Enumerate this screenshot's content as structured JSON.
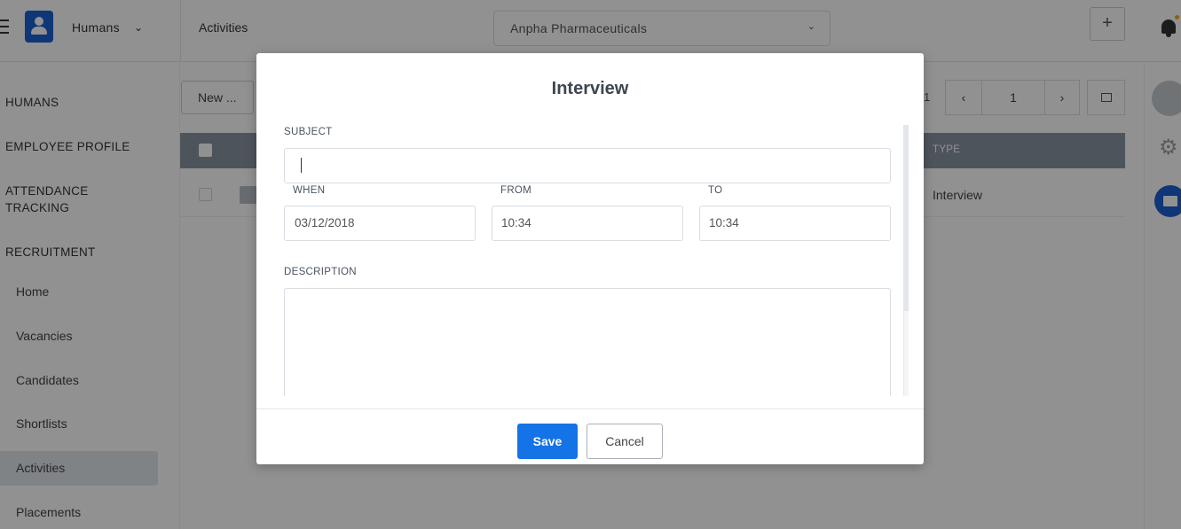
{
  "app": {
    "switcher_label": "Humans",
    "page_title": "Activities",
    "company": "Anpha Pharmaceuticals",
    "add_label": "+"
  },
  "sidebar": {
    "sections": [
      "HUMANS",
      "EMPLOYEE PROFILE",
      "ATTENDANCE TRACKING",
      "RECRUITMENT"
    ],
    "items": [
      "Home",
      "Vacancies",
      "Candidates",
      "Shortlists",
      "Activities",
      "Placements"
    ],
    "active_item": "Activities"
  },
  "toolbar": {
    "new_label": "New ...",
    "pager_count": "1",
    "pager_page": "1",
    "prev_icon": "‹",
    "next_icon": "›"
  },
  "table": {
    "columns": [
      "TYPE"
    ],
    "rows": [
      {
        "type": "Interview"
      }
    ]
  },
  "modal": {
    "title": "Interview",
    "subject_label": "SUBJECT",
    "subject_value": "",
    "when_label": "WHEN",
    "when_value": "03/12/2018",
    "from_label": "FROM",
    "from_value": "10:34",
    "to_label": "TO",
    "to_value": "10:34",
    "description_label": "DESCRIPTION",
    "description_value": "",
    "save_label": "Save",
    "cancel_label": "Cancel"
  },
  "colors": {
    "primary": "#1473e6",
    "brand": "#1b5fd1",
    "table_header": "#8a95a3",
    "notification": "#f5a623"
  },
  "icons": [
    "hamburger-icon",
    "logo-icon",
    "chevron-down-icon",
    "bell-icon",
    "gear-icon",
    "mail-icon"
  ]
}
